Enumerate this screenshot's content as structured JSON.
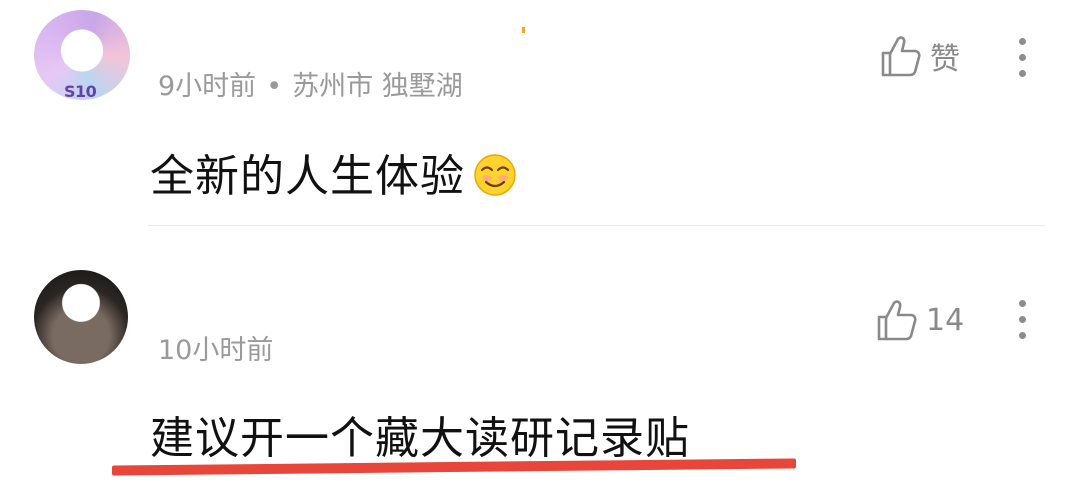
{
  "comments": [
    {
      "avatar_badge": "S10",
      "time": "9小时前",
      "separator": "•",
      "location": "苏州市 独墅湖",
      "text": "全新的人生体验",
      "emoji": "grinning-face-emoji",
      "like_label": "赞",
      "like_icon": "thumbs-up-icon",
      "more_icon": "more-vertical-icon"
    },
    {
      "time": "10小时前",
      "text": "建议开一个藏大读研记录贴",
      "like_label": "14",
      "like_icon": "thumbs-up-icon",
      "more_icon": "more-vertical-icon",
      "highlight_color": "#e8463a"
    }
  ]
}
